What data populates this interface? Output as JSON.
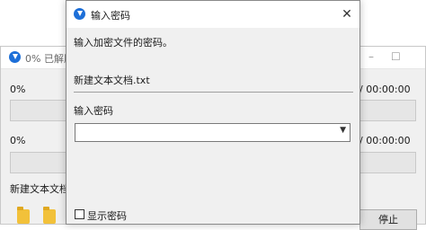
{
  "background_window": {
    "title": "0% 已解压",
    "progress1": {
      "percent_label": "0%",
      "timer": "/ 00:00:00",
      "value_percent": 0
    },
    "progress2": {
      "percent_label": "0%",
      "timer": "/ 00:00:00",
      "value_percent": 0
    },
    "current_file": "新建文本文档",
    "stop_button": "停止"
  },
  "dialog": {
    "title": "输入密码",
    "prompt": "输入加密文件的密码。",
    "file_name": "新建文本文档.txt",
    "password_label": "输入密码",
    "password_value": "",
    "show_password_label": "显示密码",
    "show_password_checked": false
  },
  "colors": {
    "accent": "#1d6fd8",
    "progress": "#06b025",
    "folder": "#f2c13a"
  }
}
